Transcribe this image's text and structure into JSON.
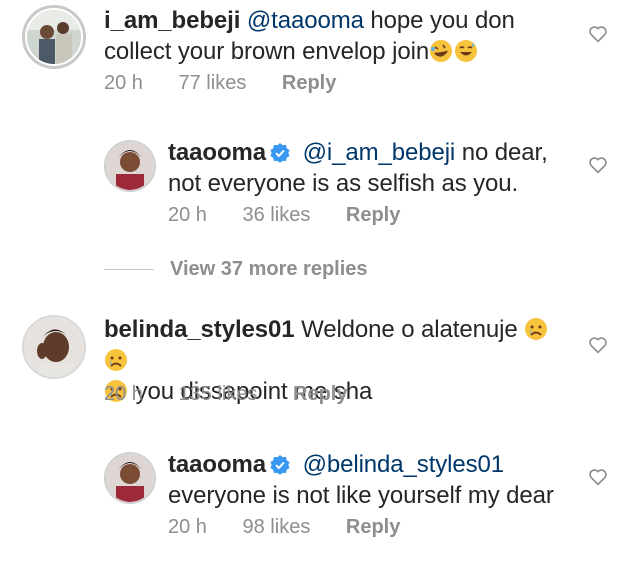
{
  "comments": [
    {
      "username": "i_am_bebeji",
      "mention": "@taaooma",
      "text": " hope you don collect your brown envelop join",
      "emoji_after": [
        "rofl-emoji",
        "grin-sweat-emoji"
      ],
      "time": "20 h",
      "likes": "77 likes",
      "reply": "Reply"
    },
    {
      "username": "taaooma",
      "verified": true,
      "mention": "@i_am_bebeji",
      "text": " no dear, not everyone is as selfish as you.",
      "time": "20 h",
      "likes": "36 likes",
      "reply": "Reply"
    },
    {
      "username": "belinda_styles01",
      "text": " Weldone o alatenuje",
      "emoji_after": [
        "crying-emoji",
        "crying-emoji"
      ],
      "text2": " you dissapoint me sha",
      "emoji_before_text2": "crying-emoji",
      "time": "20 h",
      "likes": "135 likes",
      "reply": "Reply"
    },
    {
      "username": "taaooma",
      "verified": true,
      "mention": "@belinda_styles01",
      "text": "everyone is not like yourself my dear",
      "time": "20 h",
      "likes": "98 likes",
      "reply": "Reply"
    }
  ],
  "view_more": "View 37 more replies",
  "colors": {
    "text": "#262626",
    "mention": "#00376b",
    "meta": "#8e8e8e",
    "verified": "#3897f0"
  }
}
